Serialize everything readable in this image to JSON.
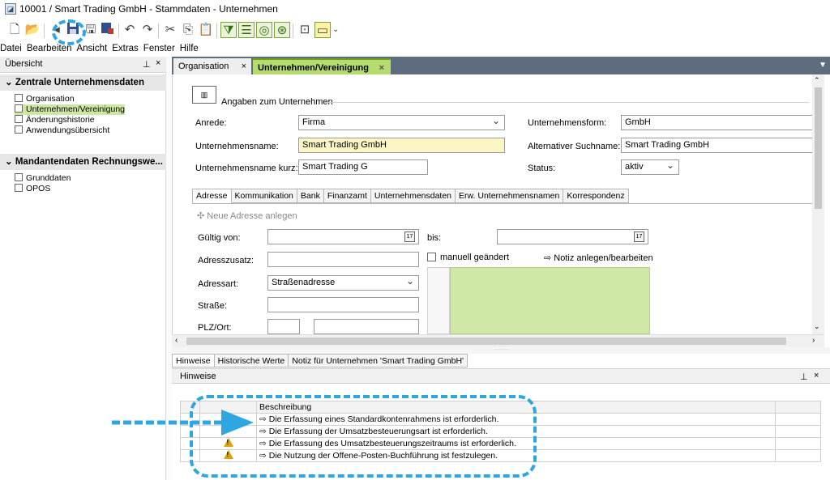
{
  "window": {
    "title": "10001 / Smart Trading GmbH - Stammdaten - Unternehmen"
  },
  "menu": [
    "Datei",
    "Bearbeiten",
    "Ansicht",
    "Extras",
    "Fenster",
    "Hilfe"
  ],
  "left_panel": {
    "header": "Übersicht",
    "pin": "⊥",
    "close": "×",
    "group1": {
      "title": "Zentrale Unternehmensdaten",
      "items": [
        "Organisation",
        "Unternehmen/Vereinigung",
        "Änderungshistorie",
        "Anwendungsübersicht"
      ]
    },
    "group2": {
      "title": "Mandantendaten Rechnungswe...",
      "items": [
        "Grunddaten",
        "OPOS"
      ]
    }
  },
  "doc_tabs": [
    {
      "label": "Organisation",
      "close": "×"
    },
    {
      "label": "Unternehmen/Vereinigung",
      "close": "×"
    }
  ],
  "section_title": "Angaben zum Unternehmen",
  "form": {
    "anrede_label": "Anrede:",
    "anrede_value": "Firma",
    "name_label": "Unternehmensname:",
    "name_value": "Smart Trading GmbH",
    "kurz_label": "Unternehmensname kurz:",
    "kurz_value": "Smart Trading G",
    "form_label": "Unternehmensform:",
    "form_value": "GmbH",
    "suchname_label": "Alternativer Suchname:",
    "suchname_value": "Smart Trading GmbH",
    "status_label": "Status:",
    "status_value": "aktiv"
  },
  "sub_tabs": [
    "Adresse",
    "Kommunikation",
    "Bank",
    "Finanzamt",
    "Unternehmensdaten",
    "Erw. Unternehmensnamen",
    "Korrespondenz"
  ],
  "address": {
    "new_address": "Neue Adresse anlegen",
    "gueltig_label": "Gültig von:",
    "bis_label": "bis:",
    "zusatz_label": "Adresszusatz:",
    "manuell_label": "manuell geändert",
    "notiz_label": "Notiz anlegen/bearbeiten",
    "art_label": "Adressart:",
    "art_value": "Straßenadresse",
    "strasse_label": "Straße:",
    "plz_label": "PLZ/Ort:"
  },
  "bottom": {
    "tabs": [
      "Hinweise",
      "Historische Werte",
      "Notiz für Unternehmen 'Smart Trading GmbH'"
    ],
    "panel_title": "Hinweise",
    "column": "Beschreibung",
    "rows": [
      {
        "warn": false,
        "text": "Die Erfassung eines Standardkontenrahmens ist erforderlich."
      },
      {
        "warn": false,
        "text": "Die Erfassung der Umsatzbesteuerungsart ist erforderlich."
      },
      {
        "warn": true,
        "text": "Die Erfassung des Umsatzbesteuerungszeitraums ist erforderlich."
      },
      {
        "warn": true,
        "text": "Die Nutzung der Offene-Posten-Buchführung ist festzulegen."
      }
    ]
  },
  "colors": {
    "accent_green": "#cfe7a4",
    "tab_dark": "#5d6d7e",
    "annotation_blue": "#2ea6e0",
    "highlight_yellow": "#fbf6c4"
  }
}
